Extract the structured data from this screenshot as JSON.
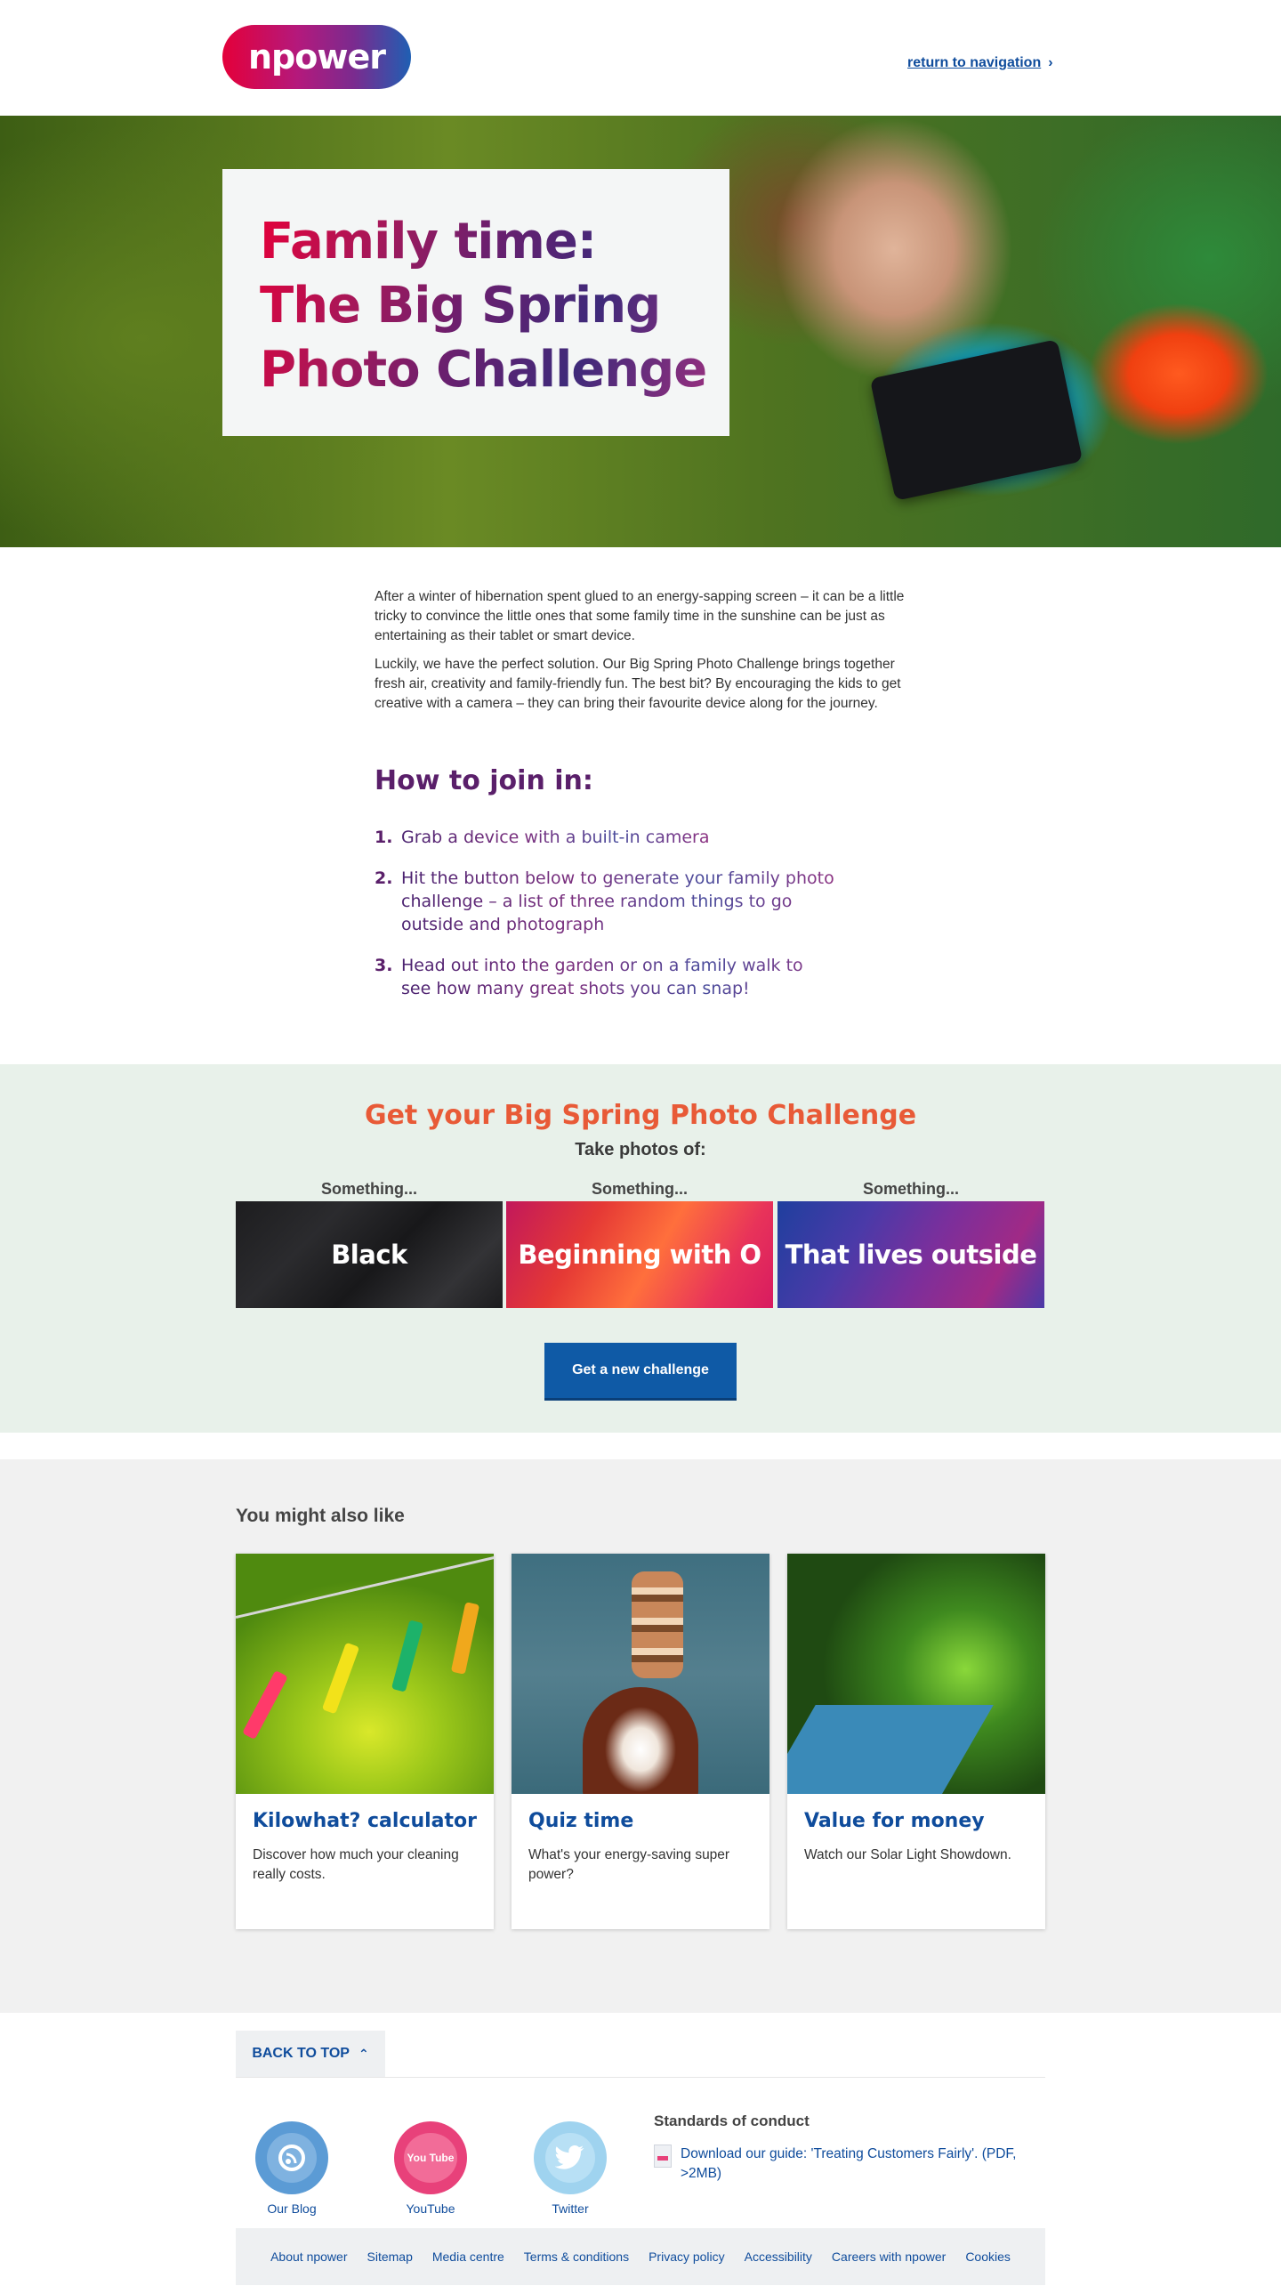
{
  "header": {
    "logo_text": "npower",
    "return_link": "return to navigation",
    "return_chevron": "›"
  },
  "hero": {
    "title": "Family time:\nThe Big Spring\nPhoto Challenge"
  },
  "intro": {
    "paragraphs": [
      "After a winter of hibernation spent glued to an energy-sapping screen – it can be a little tricky to convince the little ones that some family time in the sunshine can be just as entertaining as their tablet or smart device.",
      "Luckily, we have the perfect solution. Our Big Spring Photo Challenge brings together fresh air, creativity and family-friendly fun. The best bit? By encouraging the kids to get creative with a camera – they can bring their favourite device along for the journey."
    ]
  },
  "howto": {
    "title": "How to join in:",
    "steps": [
      {
        "num": "1.",
        "text": "Grab a device with a built-in camera"
      },
      {
        "num": "2.",
        "text": "Hit the button below to generate your family photo challenge – a list of three random things to go outside and photograph"
      },
      {
        "num": "3.",
        "text": "Head out into the garden or on a family walk to see how many great shots you can snap!"
      }
    ]
  },
  "challenge": {
    "title": "Get your Big Spring Photo Challenge",
    "subtitle": "Take photos of:",
    "tiles": [
      {
        "label": "Something...",
        "value": "Black"
      },
      {
        "label": "Something...",
        "value": "Beginning with O"
      },
      {
        "label": "Something...",
        "value": "That lives outside"
      }
    ],
    "button_label": "Get a new challenge"
  },
  "related": {
    "title": "You might also like",
    "cards": [
      {
        "title": "Kilowhat? calculator",
        "desc": "Discover how much your cleaning really costs."
      },
      {
        "title": "Quiz time",
        "desc": "What's your energy-saving super power?"
      },
      {
        "title": "Value for money",
        "desc": "Watch our Solar Light Showdown."
      }
    ]
  },
  "footer": {
    "back_to_top": "BACK TO TOP",
    "back_chevron": "⌃",
    "social": [
      {
        "label": "Our Blog",
        "icon": "blog-icon",
        "color": "#5b9bd5"
      },
      {
        "label": "YouTube",
        "icon": "youtube-icon",
        "color": "#e8417a"
      },
      {
        "label": "Twitter",
        "icon": "twitter-icon",
        "color": "#9fd3ef"
      }
    ],
    "youtube_glyph": "You Tube",
    "standards_title": "Standards of conduct",
    "standards_link": "Download our guide: 'Treating Customers Fairly'. (PDF, >2MB)",
    "links": [
      "About npower",
      "Sitemap",
      "Media centre",
      "Terms & conditions",
      "Privacy policy",
      "Accessibility",
      "Careers with npower",
      "Cookies"
    ]
  },
  "colors": {
    "brand_blue": "#0f4c9c",
    "challenge_orange": "#e85a37",
    "title_purple": "#5a1f6a",
    "challenge_bg": "#e8f1ea",
    "related_bg": "#f1f1f1"
  }
}
